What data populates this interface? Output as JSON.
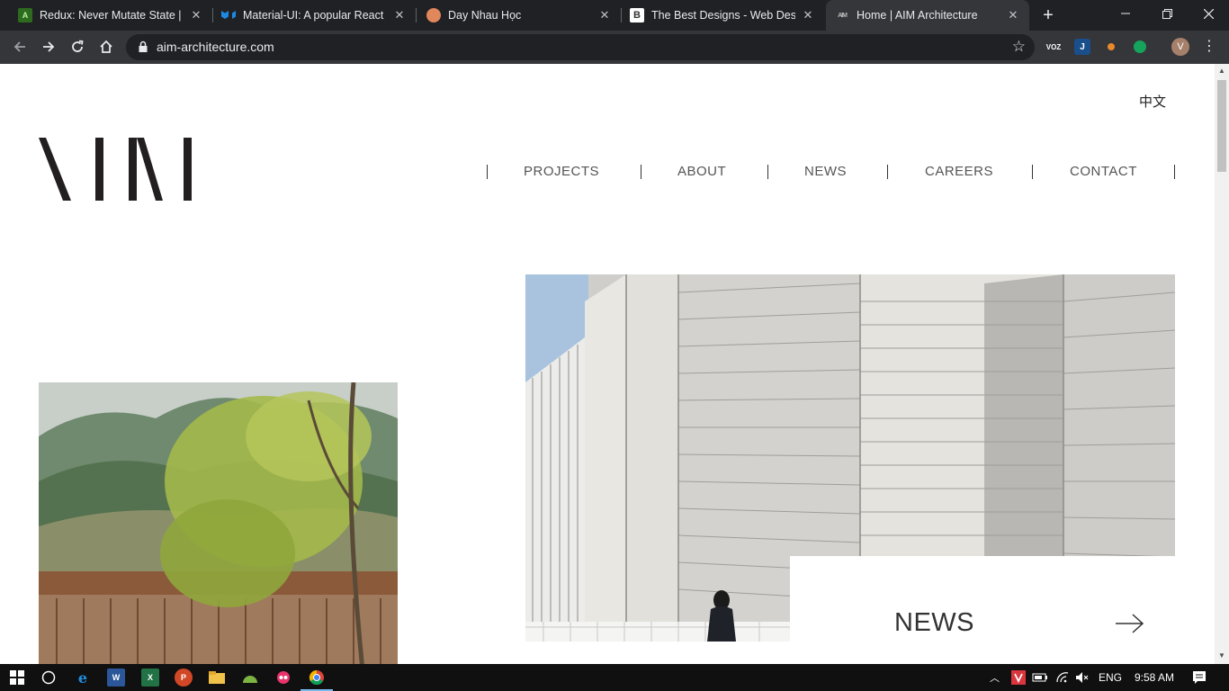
{
  "browser": {
    "tabs": [
      {
        "title": "Redux: Never Mutate State | Le",
        "favicon": "redux-favicon",
        "color": "#4b8a2f",
        "letter": "A"
      },
      {
        "title": "Material-UI: A popular React U",
        "favicon": "material-ui-favicon",
        "color": "#1e88e5",
        "letter": ""
      },
      {
        "title": "Day Nhau Học",
        "favicon": "day-nhau-hoc-favicon",
        "color": "#e0875b",
        "letter": ""
      },
      {
        "title": "The Best Designs - Web Desigr",
        "favicon": "best-designs-favicon",
        "color": "#ffffff",
        "letter": "B"
      },
      {
        "title": "Home | AIM Architecture",
        "favicon": "aim-favicon",
        "color": "#35363a",
        "letter": "AIM"
      }
    ],
    "url": "aim-architecture.com",
    "profile_initial": "V"
  },
  "site": {
    "language_toggle": "中文",
    "nav": [
      "PROJECTS",
      "ABOUT",
      "NEWS",
      "CAREERS",
      "CONTACT"
    ],
    "news_card": {
      "label": "NEWS"
    }
  },
  "taskbar": {
    "language": "ENG",
    "time": "9:58 AM"
  },
  "colors": {
    "chrome_dark": "#202124",
    "chrome_toolbar": "#35363a",
    "nav_text": "#555555",
    "logo": "#231f20"
  }
}
